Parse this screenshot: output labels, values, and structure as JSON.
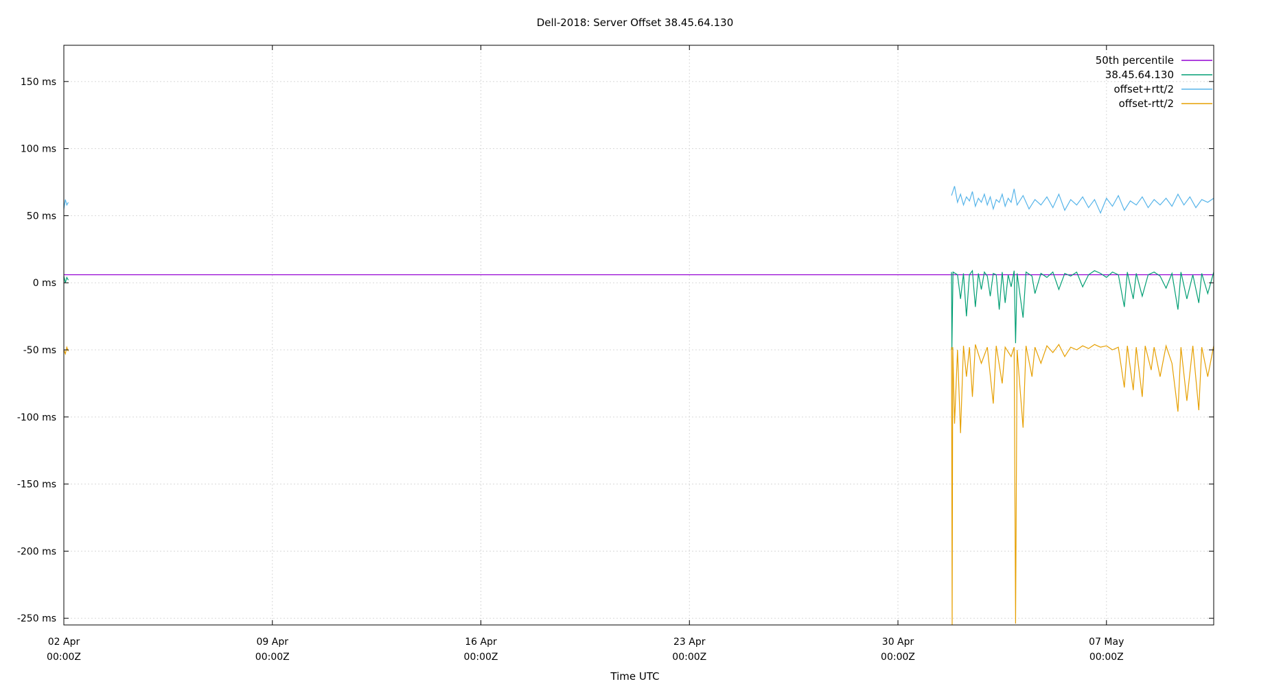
{
  "chart_data": {
    "type": "line",
    "title": "Dell-2018: Server Offset 38.45.64.130",
    "xlabel": "Time UTC",
    "ylabel": "",
    "x_unit": "days since 02 Apr 00:00Z",
    "xlim": [
      0,
      38.6
    ],
    "ylim": [
      -255,
      177
    ],
    "x_ticks": [
      {
        "value": 0,
        "line1": "02 Apr",
        "line2": "00:00Z"
      },
      {
        "value": 7,
        "line1": "09 Apr",
        "line2": "00:00Z"
      },
      {
        "value": 14,
        "line1": "16 Apr",
        "line2": "00:00Z"
      },
      {
        "value": 21,
        "line1": "23 Apr",
        "line2": "00:00Z"
      },
      {
        "value": 28,
        "line1": "30 Apr",
        "line2": "00:00Z"
      },
      {
        "value": 35,
        "line1": "07 May",
        "line2": "00:00Z"
      }
    ],
    "y_ticks": [
      {
        "value": 150,
        "label": "150 ms"
      },
      {
        "value": 100,
        "label": "100 ms"
      },
      {
        "value": 50,
        "label": "50 ms"
      },
      {
        "value": 0,
        "label": "0 ms"
      },
      {
        "value": -50,
        "label": "-50 ms"
      },
      {
        "value": -100,
        "label": "-100 ms"
      },
      {
        "value": -150,
        "label": "-150 ms"
      },
      {
        "value": -200,
        "label": "-200 ms"
      },
      {
        "value": -250,
        "label": "-250 ms"
      }
    ],
    "grid": true,
    "legend_position": "top-right",
    "series": [
      {
        "name": "50th percentile",
        "color": "#9400d3",
        "points": [
          [
            0,
            6
          ],
          [
            38.6,
            6
          ]
        ]
      },
      {
        "name": "38.45.64.130",
        "color": "#009e73",
        "points": [
          [
            0.0,
            5
          ],
          [
            0.05,
            0
          ],
          [
            0.1,
            4
          ],
          [
            0.15,
            2
          ],
          [
            29.8,
            8
          ],
          [
            29.81,
            -50
          ],
          [
            29.85,
            8
          ],
          [
            30.0,
            6
          ],
          [
            30.1,
            -12
          ],
          [
            30.2,
            7
          ],
          [
            30.3,
            -25
          ],
          [
            30.4,
            6
          ],
          [
            30.5,
            9
          ],
          [
            30.6,
            -18
          ],
          [
            30.7,
            7
          ],
          [
            30.8,
            -5
          ],
          [
            30.9,
            8
          ],
          [
            31.0,
            5
          ],
          [
            31.1,
            -10
          ],
          [
            31.2,
            7
          ],
          [
            31.3,
            6
          ],
          [
            31.4,
            -20
          ],
          [
            31.5,
            8
          ],
          [
            31.6,
            -15
          ],
          [
            31.7,
            6
          ],
          [
            31.8,
            -3
          ],
          [
            31.9,
            9
          ],
          [
            31.95,
            -45
          ],
          [
            32.0,
            7
          ],
          [
            32.2,
            -26
          ],
          [
            32.3,
            8
          ],
          [
            32.5,
            5
          ],
          [
            32.6,
            -8
          ],
          [
            32.8,
            7
          ],
          [
            33.0,
            4
          ],
          [
            33.2,
            8
          ],
          [
            33.4,
            -5
          ],
          [
            33.6,
            7
          ],
          [
            33.8,
            5
          ],
          [
            34.0,
            8
          ],
          [
            34.2,
            -3
          ],
          [
            34.4,
            6
          ],
          [
            34.6,
            9
          ],
          [
            34.8,
            7
          ],
          [
            35.0,
            4
          ],
          [
            35.2,
            8
          ],
          [
            35.4,
            6
          ],
          [
            35.6,
            -18
          ],
          [
            35.7,
            8
          ],
          [
            35.9,
            -12
          ],
          [
            36.0,
            7
          ],
          [
            36.2,
            -10
          ],
          [
            36.4,
            6
          ],
          [
            36.6,
            8
          ],
          [
            36.8,
            5
          ],
          [
            37.0,
            -4
          ],
          [
            37.2,
            7
          ],
          [
            37.4,
            -20
          ],
          [
            37.5,
            8
          ],
          [
            37.7,
            -12
          ],
          [
            37.9,
            6
          ],
          [
            38.1,
            -15
          ],
          [
            38.2,
            7
          ],
          [
            38.4,
            -8
          ],
          [
            38.6,
            8
          ]
        ]
      },
      {
        "name": "offset+rtt/2",
        "color": "#56b4e9",
        "points": [
          [
            0.0,
            55
          ],
          [
            0.05,
            62
          ],
          [
            0.1,
            58
          ],
          [
            0.15,
            60
          ],
          [
            29.8,
            65
          ],
          [
            29.9,
            72
          ],
          [
            30.0,
            60
          ],
          [
            30.1,
            66
          ],
          [
            30.2,
            58
          ],
          [
            30.3,
            64
          ],
          [
            30.4,
            61
          ],
          [
            30.5,
            68
          ],
          [
            30.6,
            57
          ],
          [
            30.7,
            63
          ],
          [
            30.8,
            60
          ],
          [
            30.9,
            66
          ],
          [
            31.0,
            58
          ],
          [
            31.1,
            64
          ],
          [
            31.2,
            55
          ],
          [
            31.3,
            62
          ],
          [
            31.4,
            60
          ],
          [
            31.5,
            66
          ],
          [
            31.6,
            57
          ],
          [
            31.7,
            63
          ],
          [
            31.8,
            60
          ],
          [
            31.9,
            70
          ],
          [
            32.0,
            58
          ],
          [
            32.2,
            65
          ],
          [
            32.4,
            55
          ],
          [
            32.6,
            62
          ],
          [
            32.8,
            58
          ],
          [
            33.0,
            64
          ],
          [
            33.2,
            56
          ],
          [
            33.4,
            66
          ],
          [
            33.6,
            54
          ],
          [
            33.8,
            62
          ],
          [
            34.0,
            58
          ],
          [
            34.2,
            64
          ],
          [
            34.4,
            56
          ],
          [
            34.6,
            62
          ],
          [
            34.8,
            52
          ],
          [
            35.0,
            63
          ],
          [
            35.2,
            57
          ],
          [
            35.4,
            65
          ],
          [
            35.6,
            54
          ],
          [
            35.8,
            61
          ],
          [
            36.0,
            58
          ],
          [
            36.2,
            64
          ],
          [
            36.4,
            56
          ],
          [
            36.6,
            62
          ],
          [
            36.8,
            58
          ],
          [
            37.0,
            63
          ],
          [
            37.2,
            57
          ],
          [
            37.4,
            66
          ],
          [
            37.6,
            58
          ],
          [
            37.8,
            64
          ],
          [
            38.0,
            56
          ],
          [
            38.2,
            62
          ],
          [
            38.4,
            60
          ],
          [
            38.6,
            63
          ]
        ]
      },
      {
        "name": "offset-rtt/2",
        "color": "#e69f00",
        "points": [
          [
            0.0,
            -50
          ],
          [
            0.05,
            -53
          ],
          [
            0.1,
            -48
          ],
          [
            0.15,
            -51
          ],
          [
            29.8,
            -48
          ],
          [
            29.82,
            -255
          ],
          [
            29.84,
            -48
          ],
          [
            29.9,
            -105
          ],
          [
            30.0,
            -50
          ],
          [
            30.1,
            -112
          ],
          [
            30.2,
            -47
          ],
          [
            30.3,
            -70
          ],
          [
            30.4,
            -48
          ],
          [
            30.5,
            -85
          ],
          [
            30.6,
            -46
          ],
          [
            30.8,
            -60
          ],
          [
            31.0,
            -48
          ],
          [
            31.2,
            -90
          ],
          [
            31.3,
            -47
          ],
          [
            31.5,
            -75
          ],
          [
            31.6,
            -48
          ],
          [
            31.8,
            -55
          ],
          [
            31.9,
            -48
          ],
          [
            31.95,
            -254
          ],
          [
            32.0,
            -50
          ],
          [
            32.2,
            -108
          ],
          [
            32.3,
            -47
          ],
          [
            32.5,
            -70
          ],
          [
            32.6,
            -48
          ],
          [
            32.8,
            -60
          ],
          [
            33.0,
            -47
          ],
          [
            33.2,
            -52
          ],
          [
            33.4,
            -46
          ],
          [
            33.6,
            -55
          ],
          [
            33.8,
            -48
          ],
          [
            34.0,
            -50
          ],
          [
            34.2,
            -47
          ],
          [
            34.4,
            -49
          ],
          [
            34.6,
            -46
          ],
          [
            34.8,
            -48
          ],
          [
            35.0,
            -47
          ],
          [
            35.2,
            -50
          ],
          [
            35.4,
            -48
          ],
          [
            35.6,
            -78
          ],
          [
            35.7,
            -47
          ],
          [
            35.9,
            -80
          ],
          [
            36.0,
            -48
          ],
          [
            36.2,
            -85
          ],
          [
            36.3,
            -47
          ],
          [
            36.5,
            -65
          ],
          [
            36.6,
            -48
          ],
          [
            36.8,
            -70
          ],
          [
            37.0,
            -47
          ],
          [
            37.2,
            -60
          ],
          [
            37.4,
            -96
          ],
          [
            37.5,
            -48
          ],
          [
            37.7,
            -88
          ],
          [
            37.9,
            -47
          ],
          [
            38.1,
            -95
          ],
          [
            38.2,
            -48
          ],
          [
            38.4,
            -70
          ],
          [
            38.6,
            -47
          ]
        ]
      }
    ]
  }
}
